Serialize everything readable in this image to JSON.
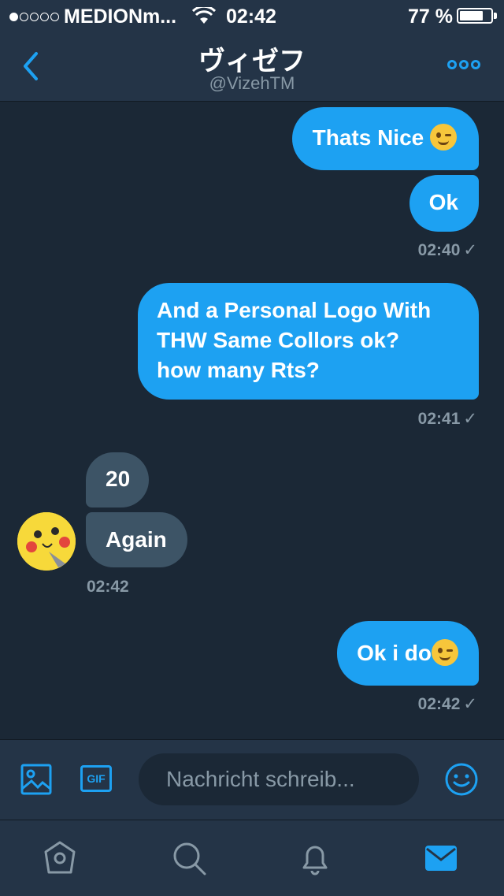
{
  "status_bar": {
    "carrier": "MEDIONm...",
    "time": "02:42",
    "battery_percent": "77 %",
    "battery_level": 0.77,
    "signal_bars_filled": 1
  },
  "header": {
    "title": "ヴィゼフ",
    "handle": "@VizehTM"
  },
  "messages": [
    {
      "direction": "out",
      "text": "Thats Nice",
      "emoji": "winking-face"
    },
    {
      "direction": "out",
      "text": "Ok"
    },
    {
      "timestamp": "02:40",
      "check": "✓"
    },
    {
      "direction": "out",
      "lines": [
        "And a Personal Logo With",
        "THW Same Collors ok?",
        "how many Rts?"
      ]
    },
    {
      "timestamp": "02:41",
      "check": "✓"
    },
    {
      "direction": "in",
      "text": "20"
    },
    {
      "direction": "in",
      "text": "Again"
    },
    {
      "timestamp": "02:42"
    },
    {
      "direction": "out",
      "text": "Ok i do",
      "emoji": "winking-face"
    },
    {
      "timestamp": "02:42",
      "check": "✓"
    }
  ],
  "composer": {
    "placeholder": "Nachricht schreib...",
    "gif_label": "GIF",
    "icons": [
      "image-icon",
      "gif-icon",
      "emoji-icon"
    ]
  },
  "tabbar": {
    "icons": [
      "home-icon",
      "search-icon",
      "notifications-icon",
      "messages-icon"
    ],
    "active": "messages-icon"
  },
  "colors": {
    "accent": "#1da1f2",
    "background": "#1b2836",
    "bar": "#243447",
    "incoming_bubble": "#3d5466",
    "secondary_text": "#8899a6"
  }
}
